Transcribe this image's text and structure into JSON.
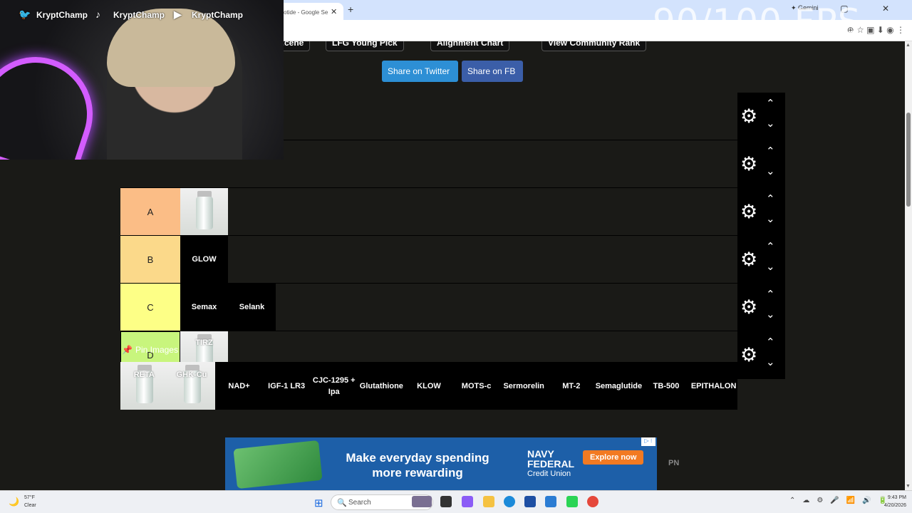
{
  "browser": {
    "active_tab_title": "otide - Google Se",
    "tab_close": "✕",
    "new_tab": "+",
    "gemini_tab": "✦ Gemini",
    "window_controls": "–  ▢  ✕"
  },
  "overlay": {
    "fps": "90/100 FPS"
  },
  "stream": {
    "twitter": "KryptChamp",
    "tiktok": "KryptChamp",
    "youtube": "KryptChamp"
  },
  "toolbar": {
    "btn1": "...cene",
    "btn2": "LFG Young Pick",
    "btn3": "Alignment Chart",
    "btn4": "View Community Rank"
  },
  "share": {
    "twitter": "Share on Twitter",
    "fb": "Share on FB",
    "twitter_color": "#2d8fd5",
    "fb_color": "#3b5ea8"
  },
  "tiers": [
    {
      "label": "",
      "color": "#1a1a17",
      "items": []
    },
    {
      "label": "",
      "color": "#1a1a17",
      "items": []
    },
    {
      "label": "A",
      "color": "#fbbd86",
      "items": [
        {
          "name": "",
          "vial": true
        }
      ]
    },
    {
      "label": "B",
      "color": "#fbd98a",
      "items": [
        {
          "name": "GLOW",
          "vial": false
        }
      ]
    },
    {
      "label": "C",
      "color": "#fdff86",
      "items": [
        {
          "name": "Semax",
          "vial": false
        },
        {
          "name": "Selank",
          "vial": false
        }
      ]
    },
    {
      "label": "D",
      "color": "#c8f57d",
      "items": [
        {
          "name": "TIRZ",
          "vial": true
        }
      ]
    }
  ],
  "pin_images_label": "Pin Images",
  "pool": [
    {
      "name": "RETA",
      "vial": true
    },
    {
      "name": "GHK-Cu",
      "vial": true
    },
    {
      "name": "NAD+",
      "vial": false
    },
    {
      "name": "IGF-1 LR3",
      "vial": false
    },
    {
      "name": "CJC-1295 + Ipa",
      "vial": false
    },
    {
      "name": "Glutathione",
      "vial": false
    },
    {
      "name": "KLOW",
      "vial": false
    },
    {
      "name": "MOTS-c",
      "vial": false
    },
    {
      "name": "Sermorelin",
      "vial": false
    },
    {
      "name": "MT-2",
      "vial": false
    },
    {
      "name": "Semaglutide",
      "vial": false
    },
    {
      "name": "TB-500",
      "vial": false
    },
    {
      "name": "EPITHALON",
      "vial": false
    }
  ],
  "ad": {
    "headline": "Make everyday spending more rewarding",
    "brand_line1": "NAVY",
    "brand_line2": "FEDERAL",
    "brand_line3": "Credit Union",
    "cta": "Explore now",
    "badge": "▷ ⁝"
  },
  "pn_text": "PN",
  "taskbar": {
    "weather_temp": "57°F",
    "weather_desc": "Clear",
    "search_placeholder": "Search",
    "time": "9:43 PM",
    "date": "4/20/2026"
  }
}
